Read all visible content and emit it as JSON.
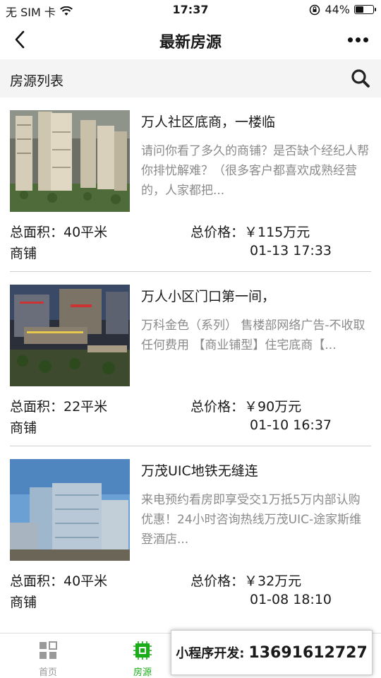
{
  "status": {
    "carrier": "无 SIM 卡",
    "time": "17:37",
    "battery": "44%",
    "battery_level": 0.44
  },
  "nav": {
    "title": "最新房源",
    "back_icon": "chevron-left-icon",
    "more_icon": "more-icon"
  },
  "section": {
    "title": "房源列表",
    "search_icon": "search-icon"
  },
  "listings": [
    {
      "title": "万人社区底商，一楼临",
      "description": "请问你看了多久的商铺？是否缺个经纪人帮你排忧解难？（很多客户都喜欢成熟经营的，人家都把...",
      "area": "总面积：40平米",
      "price": "总价格：￥115万元",
      "type": "商铺",
      "date": "01-13 17:33"
    },
    {
      "title": "万人小区门口第一间，",
      "description": "万科金色（系列） 售楼部网络广告-不收取任何费用 【商业铺型】住宅底商【...",
      "area": "总面积：22平米",
      "price": "总价格：￥90万元",
      "type": "商铺",
      "date": "01-10 16:37"
    },
    {
      "title": "万茂UIC地铁无缝连",
      "description": "来电预约看房即享受交1万抵5万内部认购优惠！24小时咨询热线万茂UIC-途家斯维登酒店...",
      "area": "总面积：40平米",
      "price": "总价格：￥32万元",
      "type": "商铺",
      "date": "01-08 18:10"
    }
  ],
  "tabs": [
    {
      "label": "首页",
      "icon": "grid-icon"
    },
    {
      "label": "房源",
      "icon": "chip-icon"
    }
  ],
  "promo": {
    "label": "小程序开发:",
    "phone": "13691612727"
  },
  "colors": {
    "accent": "#1aad19",
    "inactive": "#999999",
    "desc_text": "#8a8a8a"
  }
}
